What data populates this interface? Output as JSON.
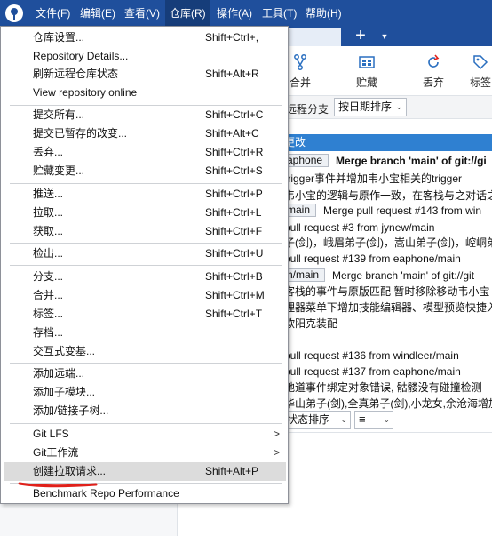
{
  "menubar": {
    "items": [
      "文件(F)",
      "编辑(E)",
      "查看(V)",
      "仓库(R)",
      "操作(A)",
      "工具(T)",
      "帮助(H)"
    ]
  },
  "toolbar": {
    "buttons": [
      "合并",
      "贮藏",
      "丢弃",
      "标签"
    ]
  },
  "filterbar": {
    "branch_label": "远程分支",
    "sort_value": "按日期排序"
  },
  "history": {
    "header": "更改",
    "rows": [
      {
        "tag": "aphone",
        "text": "Merge branch 'main' of git://gi",
        "bold": true
      },
      {
        "tag": "",
        "text": "trigger事件并增加韦小宝相关的trigger",
        "bold": false
      },
      {
        "tag": "",
        "text": "韦小宝的逻辑与原作一致，在客栈与之对话之",
        "bold": false
      },
      {
        "tag": "main",
        "text": "Merge pull request #143 from win",
        "bold": false
      },
      {
        "tag": "",
        "text": "pull request #3 from jynew/main",
        "bold": false
      },
      {
        "tag": "",
        "text": "子(剑)，峨眉弟子(剑)，嵩山弟子(剑)，崆峒弟子",
        "bold": false
      },
      {
        "tag": "",
        "text": "pull request #139 from eaphone/main",
        "bold": false
      },
      {
        "tag": "n/main",
        "text": "Merge branch 'main' of git://git",
        "bold": false
      },
      {
        "tag": "",
        "text": "客栈的事件与原版匹配 暂时移除移动韦小宝",
        "bold": false
      },
      {
        "tag": "",
        "text": "理器菜单下增加技能编辑器、模型预览快捷入",
        "bold": false
      },
      {
        "tag": "",
        "text": "欧阳克装配",
        "bold": false
      },
      {
        "tag": "",
        "text": "",
        "bold": false
      },
      {
        "tag": "",
        "text": "pull request #136 from windleer/main",
        "bold": false
      },
      {
        "tag": "",
        "text": "pull request #137 from eaphone/main",
        "bold": false
      },
      {
        "tag": "",
        "text": "地道事件绑定对象错误, 骷髅没有碰撞检测",
        "bold": false
      },
      {
        "tag": "",
        "text": "华山弟子(剑),全真弟子(剑),小龙女,余沧海增加",
        "bold": false
      }
    ],
    "status_sort": "状态排序",
    "view_select": "≡"
  },
  "dropdown": {
    "items": [
      {
        "label": "仓库设置...",
        "shortcut": "Shift+Ctrl+,"
      },
      {
        "label": "Repository Details...",
        "shortcut": ""
      },
      {
        "label": "刷新远程仓库状态",
        "shortcut": "Shift+Alt+R"
      },
      {
        "label": "View repository online",
        "shortcut": ""
      },
      {
        "label": "提交所有...",
        "shortcut": "Shift+Ctrl+C"
      },
      {
        "label": "提交已暂存的改变...",
        "shortcut": "Shift+Alt+C"
      },
      {
        "label": "丢弃...",
        "shortcut": "Shift+Ctrl+R"
      },
      {
        "label": "贮藏变更...",
        "shortcut": "Shift+Ctrl+S"
      },
      {
        "label": "推送...",
        "shortcut": "Shift+Ctrl+P"
      },
      {
        "label": "拉取...",
        "shortcut": "Shift+Ctrl+L"
      },
      {
        "label": "获取...",
        "shortcut": "Shift+Ctrl+F"
      },
      {
        "label": "检出...",
        "shortcut": "Shift+Ctrl+U"
      },
      {
        "label": "分支...",
        "shortcut": "Shift+Ctrl+B"
      },
      {
        "label": "合并...",
        "shortcut": "Shift+Ctrl+M"
      },
      {
        "label": "标签...",
        "shortcut": "Shift+Ctrl+T"
      },
      {
        "label": "存档...",
        "shortcut": ""
      },
      {
        "label": "交互式变基...",
        "shortcut": ""
      },
      {
        "label": "添加远端...",
        "shortcut": ""
      },
      {
        "label": "添加子模块...",
        "shortcut": ""
      },
      {
        "label": "添加/链接子树...",
        "shortcut": ""
      },
      {
        "label": "Git LFS",
        "shortcut": ""
      },
      {
        "label": "Git工作流",
        "shortcut": ""
      },
      {
        "label": "创建拉取请求...",
        "shortcut": "Shift+Alt+P"
      },
      {
        "label": "Benchmark Repo Performance",
        "shortcut": ""
      }
    ]
  },
  "colors": {
    "menubar": "#1f4f9c",
    "highlight": "#dcdcdc",
    "annotation": "#e0201a",
    "history_header": "#2f80d1"
  }
}
